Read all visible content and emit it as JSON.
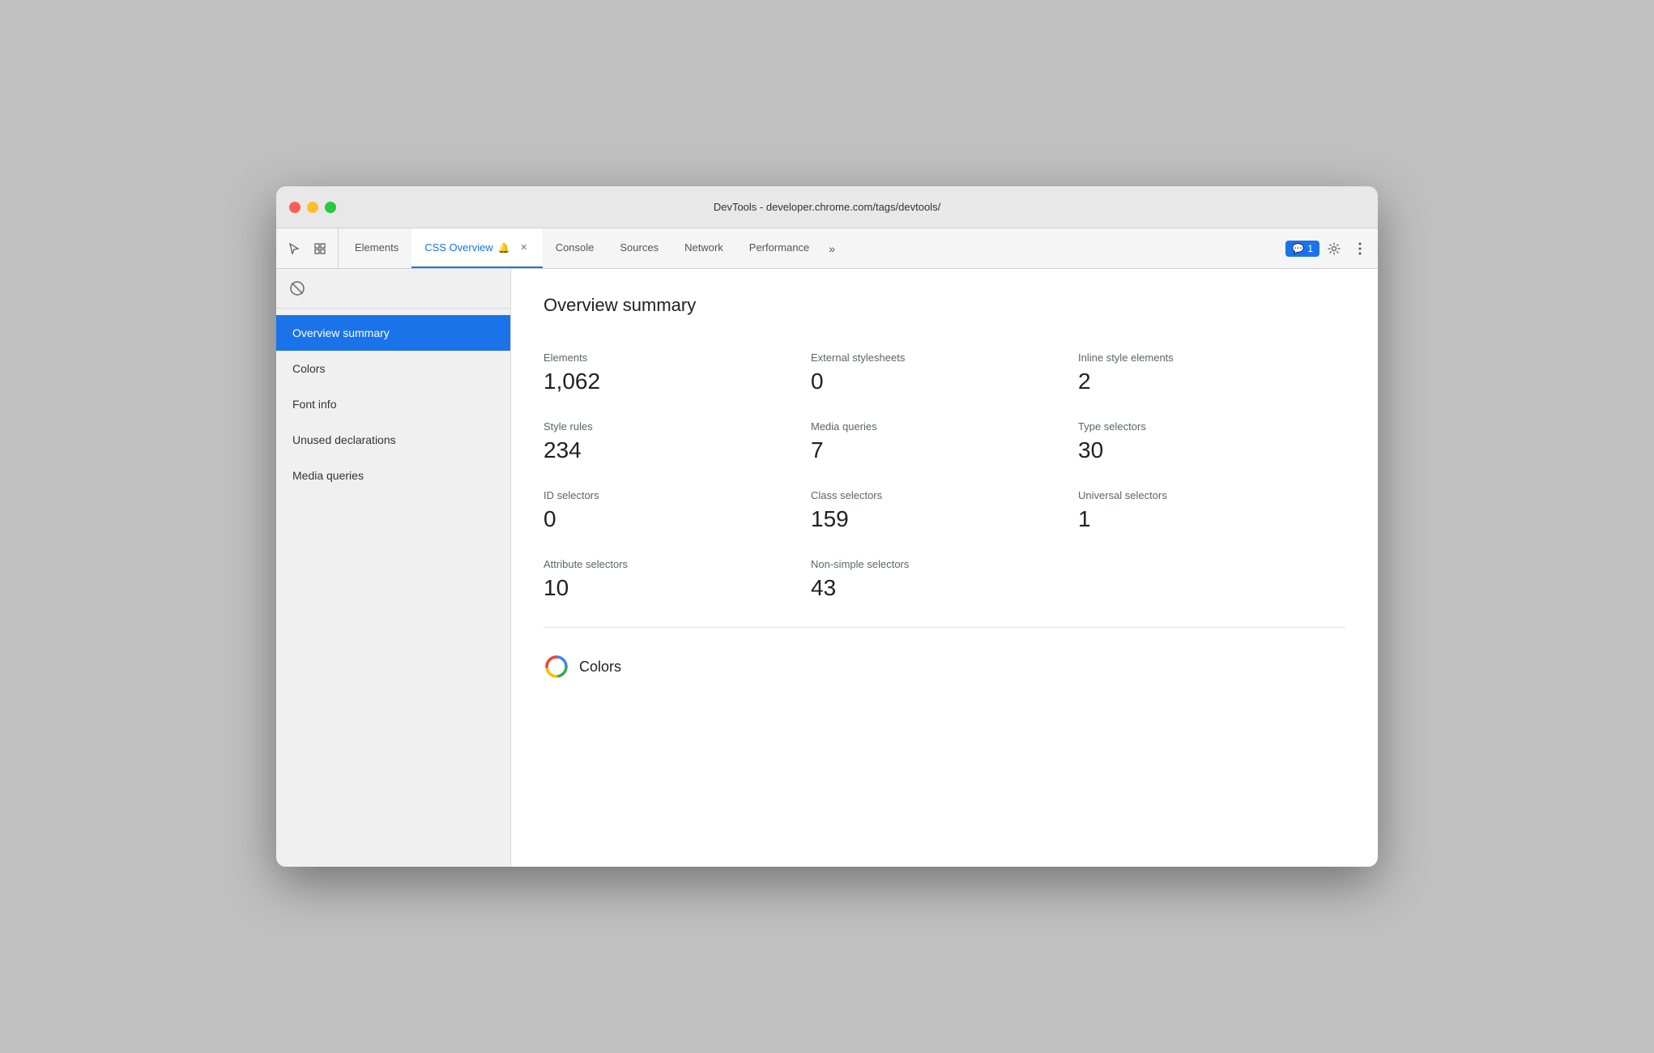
{
  "window": {
    "title": "DevTools - developer.chrome.com/tags/devtools/"
  },
  "tabs": [
    {
      "id": "elements",
      "label": "Elements",
      "active": false,
      "closeable": false
    },
    {
      "id": "css-overview",
      "label": "CSS Overview",
      "active": true,
      "closeable": true,
      "hasBell": true
    },
    {
      "id": "console",
      "label": "Console",
      "active": false,
      "closeable": false
    },
    {
      "id": "sources",
      "label": "Sources",
      "active": false,
      "closeable": false
    },
    {
      "id": "network",
      "label": "Network",
      "active": false,
      "closeable": false
    },
    {
      "id": "performance",
      "label": "Performance",
      "active": false,
      "closeable": false
    }
  ],
  "tab_more_label": "»",
  "chat_badge": "1",
  "sidebar": {
    "items": [
      {
        "id": "overview-summary",
        "label": "Overview summary",
        "active": true
      },
      {
        "id": "colors",
        "label": "Colors",
        "active": false
      },
      {
        "id": "font-info",
        "label": "Font info",
        "active": false
      },
      {
        "id": "unused-declarations",
        "label": "Unused declarations",
        "active": false
      },
      {
        "id": "media-queries",
        "label": "Media queries",
        "active": false
      }
    ]
  },
  "main": {
    "section_title": "Overview summary",
    "stats": [
      {
        "label": "Elements",
        "value": "1,062"
      },
      {
        "label": "External stylesheets",
        "value": "0"
      },
      {
        "label": "Inline style elements",
        "value": "2"
      },
      {
        "label": "Style rules",
        "value": "234"
      },
      {
        "label": "Media queries",
        "value": "7"
      },
      {
        "label": "Type selectors",
        "value": "30"
      },
      {
        "label": "ID selectors",
        "value": "0"
      },
      {
        "label": "Class selectors",
        "value": "159"
      },
      {
        "label": "Universal selectors",
        "value": "1"
      },
      {
        "label": "Attribute selectors",
        "value": "10"
      },
      {
        "label": "Non-simple selectors",
        "value": "43"
      }
    ],
    "colors_section": {
      "title": "Colors"
    }
  }
}
